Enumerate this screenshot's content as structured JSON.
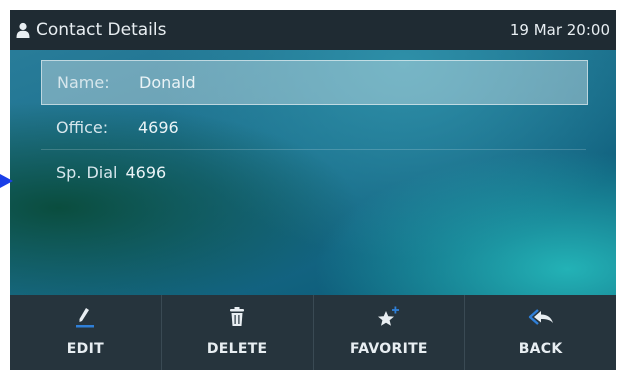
{
  "header": {
    "title": "Contact Details",
    "datetime": "19 Mar 20:00",
    "icon": "user-icon"
  },
  "fields": [
    {
      "label": "Name:",
      "value": "Donald",
      "selected": true
    },
    {
      "label": "Office:",
      "value": "4696"
    },
    {
      "label": "Sp. Dial",
      "value": "4696"
    }
  ],
  "softkeys": [
    {
      "label": "EDIT",
      "icon": "edit-pencil-icon"
    },
    {
      "label": "DELETE",
      "icon": "trash-icon"
    },
    {
      "label": "FAVORITE",
      "icon": "star-plus-icon"
    },
    {
      "label": "BACK",
      "icon": "back-arrow-icon"
    }
  ],
  "colors": {
    "titlebar": "#1f2b33",
    "softkey_bar": "#26343d",
    "accent_blue": "#2f7fd8",
    "pointer": "#1a3ee8"
  }
}
